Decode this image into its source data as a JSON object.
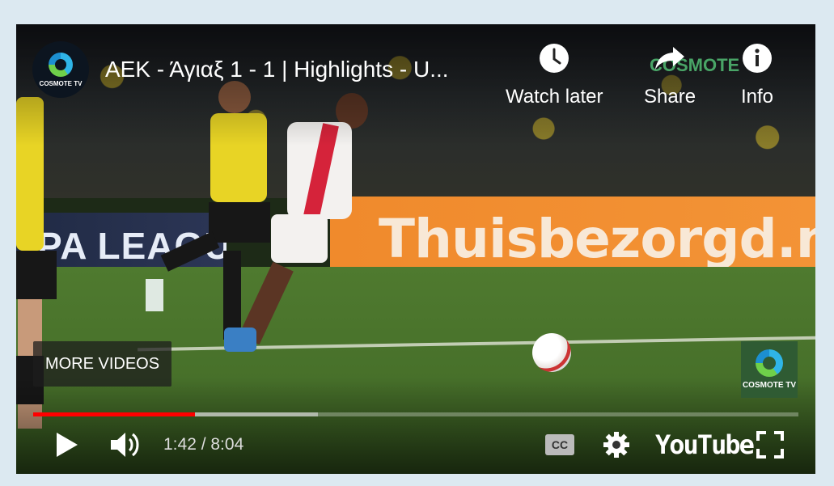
{
  "video": {
    "title": "ΑΕΚ - Άγιαξ 1 - 1 | Highlights - U...",
    "channel_avatar_text": "COSMOTE TV"
  },
  "top_actions": {
    "watch_later": "Watch later",
    "share": "Share",
    "info": "Info"
  },
  "scene": {
    "ad_left_text": "PA LEAGUE",
    "ad_right_text": "Thuisbezorgd.nl",
    "watermark_text": "COSMOTE"
  },
  "overlay": {
    "more_videos": "MORE VIDEOS",
    "corner_logo_text": "COSMOTE TV"
  },
  "playback": {
    "current_time": "1:42",
    "duration": "8:04",
    "time_display": "1:42 / 8:04",
    "played_fraction": 0.211,
    "buffered_fraction": 0.372
  },
  "controls": {
    "youtube_label": "YouTube"
  },
  "colors": {
    "progress_played": "#ff0000",
    "page_background": "#dce9f1"
  }
}
